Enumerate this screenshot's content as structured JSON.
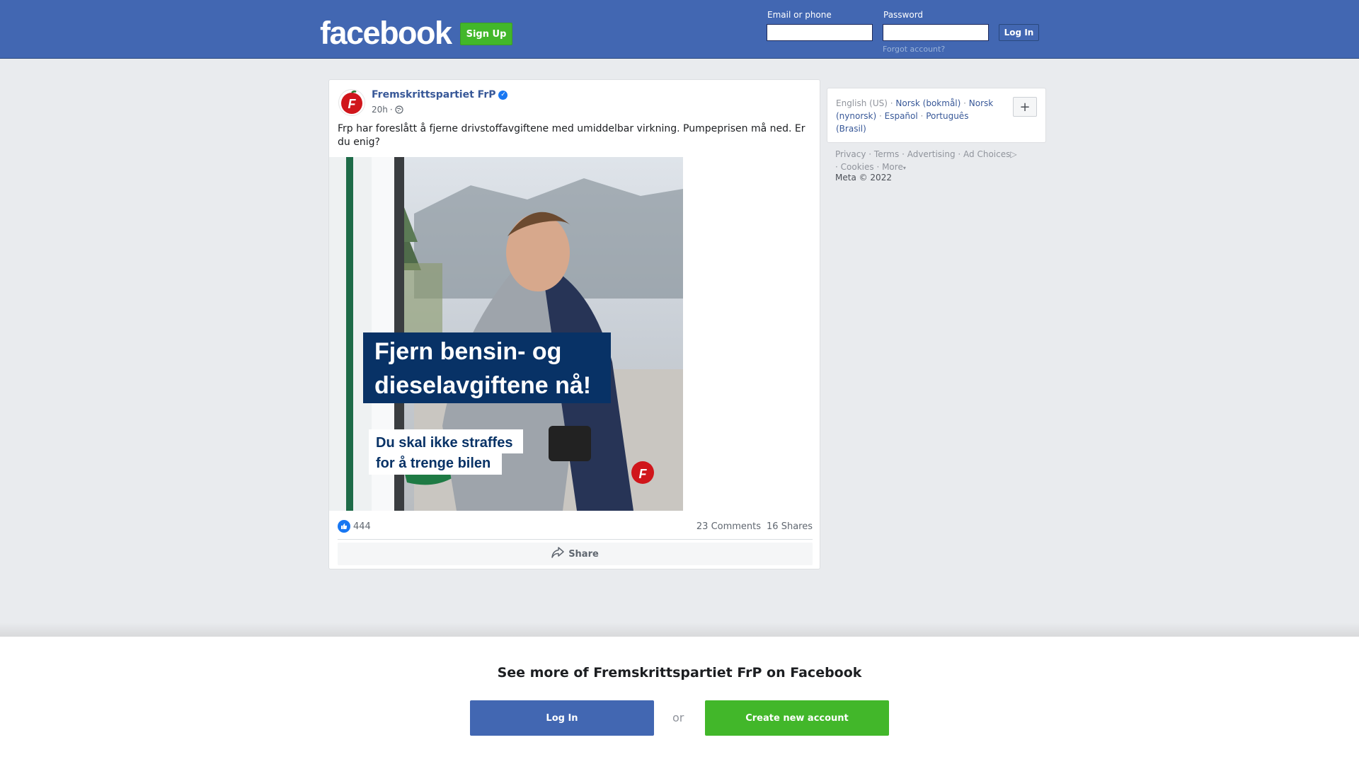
{
  "header": {
    "logo_text": "facebook",
    "signup_label": "Sign Up",
    "email_label": "Email or phone",
    "password_label": "Password",
    "login_label": "Log In",
    "forgot_label": "Forgot account?"
  },
  "post": {
    "page_name": "Fremskrittspartiet FrP",
    "time": "20h",
    "privacy_icon": "globe-icon",
    "text": "Frp har foreslått å fjerne drivstoffavgiftene med umiddelbar virkning. Pumpeprisen må ned. Er du enig?",
    "image": {
      "headline_line1": "Fjern bensin- og",
      "headline_line2": "dieselavgiftene nå!",
      "sub_line1": "Du skal ikke straffes",
      "sub_line2": "for å trenge bilen",
      "logo_text": "F"
    },
    "avatar_text": "F",
    "like_count": "444",
    "comments": "23 Comments",
    "shares": "16 Shares",
    "share_label": "Share"
  },
  "sidebar": {
    "languages": [
      {
        "label": "English (US)",
        "link": false
      },
      {
        "label": "Norsk (bokmål)",
        "link": true
      },
      {
        "label": "Norsk (nynorsk)",
        "link": true
      },
      {
        "label": "Español",
        "link": true
      },
      {
        "label": "Português (Brasil)",
        "link": true
      }
    ],
    "plus_label": "+",
    "footer_links": [
      "Privacy",
      "Terms",
      "Advertising",
      "Ad Choices",
      "Cookies",
      "More"
    ],
    "copyright": "Meta © 2022"
  },
  "banner": {
    "title": "See more of Fremskrittspartiet FrP on Facebook",
    "login_label": "Log In",
    "or_label": "or",
    "create_label": "Create new account"
  },
  "colors": {
    "brand_blue": "#4267b2",
    "green": "#42b72a",
    "link": "#385898",
    "frp_red": "#d0161b",
    "frp_navy": "#083266"
  }
}
